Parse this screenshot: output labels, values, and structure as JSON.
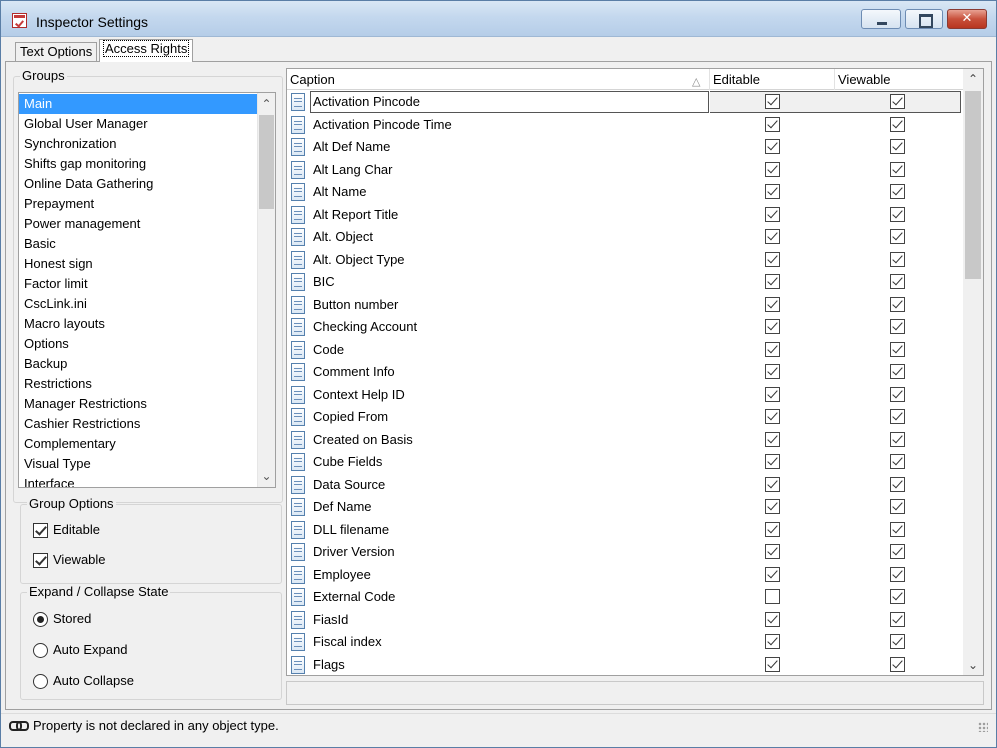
{
  "window": {
    "title": "Inspector Settings"
  },
  "tabs": [
    {
      "label": "Text Options",
      "active": false
    },
    {
      "label": "Access Rights",
      "active": true
    }
  ],
  "groups": {
    "legend": "Groups",
    "items": [
      "Main",
      "Global User Manager",
      "Synchronization",
      "Shifts gap monitoring",
      "Online Data Gathering",
      "Prepayment",
      "Power management",
      "Basic",
      "Honest sign",
      "Factor limit",
      "CscLink.ini",
      "Macro layouts",
      "Options",
      "Backup",
      "Restrictions",
      "Manager Restrictions",
      "Cashier Restrictions",
      "Complementary",
      "Visual Type",
      "Interface"
    ],
    "selected_index": 0
  },
  "group_options": {
    "legend": "Group Options",
    "editable_label": "Editable",
    "editable_checked": true,
    "viewable_label": "Viewable",
    "viewable_checked": true
  },
  "expand_collapse": {
    "legend": "Expand / Collapse State",
    "options": [
      {
        "label": "Stored",
        "selected": true
      },
      {
        "label": "Auto Expand",
        "selected": false
      },
      {
        "label": "Auto Collapse",
        "selected": false
      }
    ]
  },
  "grid": {
    "columns": {
      "caption": "Caption",
      "editable": "Editable",
      "viewable": "Viewable"
    },
    "sort_indicator": "△",
    "icon": "document-icon",
    "rows": [
      {
        "caption": "Activation Pincode",
        "editable": true,
        "viewable": true
      },
      {
        "caption": "Activation Pincode Time",
        "editable": true,
        "viewable": true
      },
      {
        "caption": "Alt Def Name",
        "editable": true,
        "viewable": true
      },
      {
        "caption": "Alt Lang Char",
        "editable": true,
        "viewable": true
      },
      {
        "caption": "Alt Name",
        "editable": true,
        "viewable": true
      },
      {
        "caption": "Alt Report Title",
        "editable": true,
        "viewable": true
      },
      {
        "caption": "Alt. Object",
        "editable": true,
        "viewable": true
      },
      {
        "caption": "Alt. Object Type",
        "editable": true,
        "viewable": true
      },
      {
        "caption": "BIC",
        "editable": true,
        "viewable": true
      },
      {
        "caption": "Button number",
        "editable": true,
        "viewable": true
      },
      {
        "caption": "Checking Account",
        "editable": true,
        "viewable": true
      },
      {
        "caption": "Code",
        "editable": true,
        "viewable": true
      },
      {
        "caption": "Comment Info",
        "editable": true,
        "viewable": true
      },
      {
        "caption": "Context Help ID",
        "editable": true,
        "viewable": true
      },
      {
        "caption": "Copied From",
        "editable": true,
        "viewable": true
      },
      {
        "caption": "Created on Basis",
        "editable": true,
        "viewable": true
      },
      {
        "caption": "Cube Fields",
        "editable": true,
        "viewable": true
      },
      {
        "caption": "Data Source",
        "editable": true,
        "viewable": true
      },
      {
        "caption": "Def Name",
        "editable": true,
        "viewable": true
      },
      {
        "caption": "DLL filename",
        "editable": true,
        "viewable": true
      },
      {
        "caption": "Driver Version",
        "editable": true,
        "viewable": true
      },
      {
        "caption": "Employee",
        "editable": true,
        "viewable": true
      },
      {
        "caption": "External Code",
        "editable": false,
        "viewable": true
      },
      {
        "caption": "FiasId",
        "editable": true,
        "viewable": true
      },
      {
        "caption": "Fiscal index",
        "editable": true,
        "viewable": true
      },
      {
        "caption": "Flags",
        "editable": true,
        "viewable": true
      }
    ],
    "selected_index": 0
  },
  "status": {
    "icon": "link-icon",
    "text": "Property is not declared in any object type."
  }
}
